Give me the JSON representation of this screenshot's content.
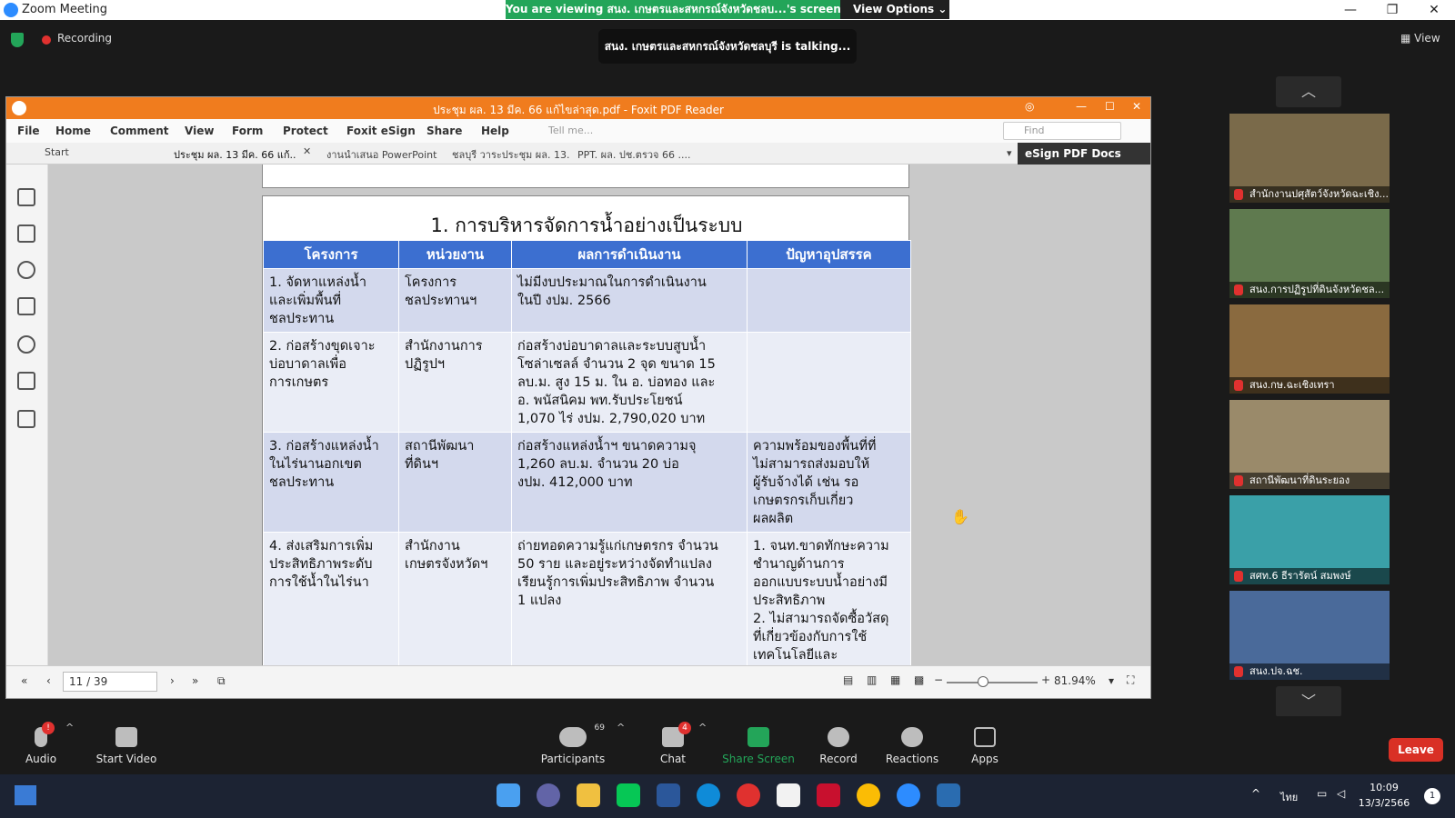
{
  "zoom": {
    "title": "Zoom Meeting",
    "banner_text": "You are viewing สนง. เกษตรและสหกรณ์จังหวัดชลบ...'s screen",
    "view_options": "View Options",
    "talking": "สนง. เกษตรและสหกรณ์จังหวัดชลบุรี is talking...",
    "recording": "Recording",
    "view": "View",
    "leave": "Leave"
  },
  "foxit": {
    "title": "ประชุม ผล. 13 มีค. 66 แก้ไขล่าสุด.pdf - Foxit PDF Reader",
    "menu": [
      "File",
      "Home",
      "Comment",
      "View",
      "Form",
      "Protect",
      "Foxit eSign",
      "Share",
      "Help"
    ],
    "tell_me": "Tell me...",
    "find": "Find",
    "tabs": [
      "Start",
      "ประชุม ผล. 13 มีค. 66 แก้...",
      "งานนำเสนอ PowerPoint",
      "ชลบุรี วาระประชุม ผล. 13...",
      "PPT. ผล. ปช.ตรวจ 66 ...."
    ],
    "esign": "eSign PDF Docs",
    "page_number": "11 / 39",
    "zoom_level": "81.94%"
  },
  "slide": {
    "title": "1. การบริหารจัดการน้ำอย่างเป็นระบบ",
    "headers": [
      "โครงการ",
      "หน่วยงาน",
      "ผลการดำเนินงาน",
      "ปัญหาอุปสรรค"
    ],
    "rows": [
      {
        "project": [
          "1. จัดหาแหล่งน้ำ",
          "และเพิ่มพื้นที่",
          "ชลประทาน"
        ],
        "agency": [
          "โครงการ",
          "ชลประทานฯ"
        ],
        "result": [
          "ไม่มีงบประมาณในการดำเนินงาน",
          "ในปี งปม. 2566"
        ],
        "problem": []
      },
      {
        "project": [
          "2. ก่อสร้างขุดเจาะ",
          "บ่อบาดาลเพื่อ",
          "การเกษตร"
        ],
        "agency": [
          "สำนักงานการ",
          "ปฏิรูปฯ"
        ],
        "result": [
          "ก่อสร้างบ่อบาดาลและระบบสูบน้ำ",
          "โซล่าเซลล์ จำนวน 2 จุด ขนาด 15",
          "ลบ.ม. สูง 15 ม. ใน อ. บ่อทอง และ",
          "อ. พนัสนิคม พท.รับประโยชน์",
          "1,070 ไร่ งปม. 2,790,020 บาท"
        ],
        "problem": []
      },
      {
        "project": [
          "3. ก่อสร้างแหล่งน้ำ",
          "ในไร่นานอกเขต",
          "ชลประทาน"
        ],
        "agency": [
          "สถานีพัฒนา",
          "ที่ดินฯ"
        ],
        "result": [
          "ก่อสร้างแหล่งน้ำฯ ขนาดความจุ",
          "1,260 ลบ.ม. จำนวน 20 บ่อ",
          "งปม. 412,000 บาท"
        ],
        "problem": [
          "ความพร้อมของพื้นที่ที่",
          "ไม่สามารถส่งมอบให้",
          "ผู้รับจ้างได้ เช่น รอ",
          "เกษตรกรเก็บเกี่ยว",
          "ผลผลิต"
        ]
      },
      {
        "project": [
          "4. ส่งเสริมการเพิ่ม",
          "ประสิทธิภาพระดับ",
          "การใช้น้ำในไร่นา"
        ],
        "agency": [
          "สำนักงาน",
          "เกษตรจังหวัดฯ"
        ],
        "result": [
          "ถ่ายทอดความรู้แก่เกษตรกร จำนวน",
          "50 ราย และอยู่ระหว่างจัดทำแปลง",
          "เรียนรู้การเพิ่มประสิทธิภาพ จำนวน",
          "1 แปลง"
        ],
        "problem": [
          "1. จนท.ขาดทักษะความ",
          "ชำนาญด้านการ",
          "ออกแบบระบบน้ำอย่างมี",
          "ประสิทธิภาพ",
          "2. ไม่สามารถจัดซื้อวัสดุ",
          "ที่เกี่ยวข้องกับการใช้",
          "เทคโนโลยีและ"
        ]
      }
    ]
  },
  "participants": [
    {
      "name": "สำนักงานปศุสัตว์จังหวัดฉะเชิง...",
      "bg": "#7a6a4a"
    },
    {
      "name": "สนง.การปฏิรูปที่ดินจังหวัดชล...",
      "bg": "#5f7a4f"
    },
    {
      "name": "สนง.กษ.ฉะเชิงเทรา",
      "bg": "#8a6a3f"
    },
    {
      "name": "สถานีพัฒนาที่ดินระยอง",
      "bg": "#9a8a6a"
    },
    {
      "name": "สศท.6 ธีรารัตน์ สมพงษ์",
      "bg": "#3aa0a8"
    },
    {
      "name": "สนง.ปจ.ฉช.",
      "bg": "#4a6a9a"
    }
  ],
  "toolbar": {
    "audio": "Audio",
    "audio_badge": "!",
    "video": "Start Video",
    "participants": "Participants",
    "participants_count": "69",
    "chat": "Chat",
    "chat_badge": "4",
    "share": "Share Screen",
    "record": "Record",
    "reactions": "Reactions",
    "apps": "Apps"
  },
  "taskbar": {
    "lang": "ไทย",
    "time": "10:09",
    "date": "13/3/2566",
    "notif_count": "1"
  },
  "colors": {
    "foxit_orange": "#f07c1e",
    "table_header": "#3c6fd0",
    "share_green": "#23a559",
    "leave_red": "#d93025"
  }
}
